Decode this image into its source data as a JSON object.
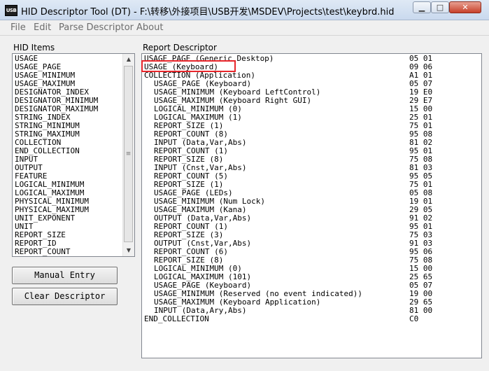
{
  "window": {
    "title": "HID Descriptor Tool (DT) - F:\\转移\\外接项目\\USB开发\\MSDEV\\Projects\\test\\keybrd.hid",
    "app_icon_text": "USB",
    "minimize_glyph": "▁",
    "maximize_glyph": "□",
    "close_glyph": "✕"
  },
  "menu": [
    "File",
    "Edit",
    "Parse Descriptor",
    "About"
  ],
  "hid_items": {
    "label": "HID Items",
    "items": [
      "USAGE",
      "USAGE_PAGE",
      "USAGE_MINIMUM",
      "USAGE_MAXIMUM",
      "DESIGNATOR_INDEX",
      "DESIGNATOR_MINIMUM",
      "DESIGNATOR_MAXIMUM",
      "STRING_INDEX",
      "STRING_MINIMUM",
      "STRING_MAXIMUM",
      "COLLECTION",
      "END_COLLECTION",
      "INPUT",
      "OUTPUT",
      "FEATURE",
      "LOGICAL_MINIMUM",
      "LOGICAL_MAXIMUM",
      "PHYSICAL_MINIMUM",
      "PHYSICAL_MAXIMUM",
      "UNIT_EXPONENT",
      "UNIT",
      "REPORT_SIZE",
      "REPORT_ID",
      "REPORT_COUNT"
    ],
    "scroll_up_glyph": "▲",
    "scroll_down_glyph": "▼",
    "thumb_grip_glyph": "≡"
  },
  "buttons": {
    "manual_entry": "Manual Entry",
    "clear_descriptor": "Clear Descriptor"
  },
  "report": {
    "label": "Report Descriptor",
    "lines": [
      {
        "text": "USAGE_PAGE (Generic Desktop)",
        "hex": "05 01",
        "indent": 0
      },
      {
        "text": "USAGE (Keyboard)",
        "hex": "09 06",
        "indent": 0
      },
      {
        "text": "COLLECTION (Application)",
        "hex": "A1 01",
        "indent": 0
      },
      {
        "text": "USAGE_PAGE (Keyboard)",
        "hex": "05 07",
        "indent": 1
      },
      {
        "text": "USAGE_MINIMUM (Keyboard LeftControl)",
        "hex": "19 E0",
        "indent": 1
      },
      {
        "text": "USAGE_MAXIMUM (Keyboard Right GUI)",
        "hex": "29 E7",
        "indent": 1
      },
      {
        "text": "LOGICAL_MINIMUM (0)",
        "hex": "15 00",
        "indent": 1
      },
      {
        "text": "LOGICAL_MAXIMUM (1)",
        "hex": "25 01",
        "indent": 1
      },
      {
        "text": "REPORT_SIZE (1)",
        "hex": "75 01",
        "indent": 1
      },
      {
        "text": "REPORT_COUNT (8)",
        "hex": "95 08",
        "indent": 1
      },
      {
        "text": "INPUT (Data,Var,Abs)",
        "hex": "81 02",
        "indent": 1
      },
      {
        "text": "REPORT_COUNT (1)",
        "hex": "95 01",
        "indent": 1
      },
      {
        "text": "REPORT_SIZE (8)",
        "hex": "75 08",
        "indent": 1
      },
      {
        "text": "INPUT (Cnst,Var,Abs)",
        "hex": "81 03",
        "indent": 1
      },
      {
        "text": "REPORT_COUNT (5)",
        "hex": "95 05",
        "indent": 1
      },
      {
        "text": "REPORT_SIZE (1)",
        "hex": "75 01",
        "indent": 1
      },
      {
        "text": "USAGE_PAGE (LEDs)",
        "hex": "05 08",
        "indent": 1
      },
      {
        "text": "USAGE_MINIMUM (Num Lock)",
        "hex": "19 01",
        "indent": 1
      },
      {
        "text": "USAGE_MAXIMUM (Kana)",
        "hex": "29 05",
        "indent": 1
      },
      {
        "text": "OUTPUT (Data,Var,Abs)",
        "hex": "91 02",
        "indent": 1
      },
      {
        "text": "REPORT_COUNT (1)",
        "hex": "95 01",
        "indent": 1
      },
      {
        "text": "REPORT_SIZE (3)",
        "hex": "75 03",
        "indent": 1
      },
      {
        "text": "OUTPUT (Cnst,Var,Abs)",
        "hex": "91 03",
        "indent": 1
      },
      {
        "text": "REPORT_COUNT (6)",
        "hex": "95 06",
        "indent": 1
      },
      {
        "text": "REPORT_SIZE (8)",
        "hex": "75 08",
        "indent": 1
      },
      {
        "text": "LOGICAL_MINIMUM (0)",
        "hex": "15 00",
        "indent": 1
      },
      {
        "text": "LOGICAL_MAXIMUM (101)",
        "hex": "25 65",
        "indent": 1
      },
      {
        "text": "USAGE_PAGE (Keyboard)",
        "hex": "05 07",
        "indent": 1
      },
      {
        "text": "USAGE_MINIMUM (Reserved (no event indicated))",
        "hex": "19 00",
        "indent": 1
      },
      {
        "text": "USAGE_MAXIMUM (Keyboard Application)",
        "hex": "29 65",
        "indent": 1
      },
      {
        "text": "INPUT (Data,Ary,Abs)",
        "hex": "81 00",
        "indent": 1
      },
      {
        "text": "END_COLLECTION",
        "hex": "C0",
        "indent": 0
      }
    ],
    "highlighted_line_index": 1
  },
  "colors": {
    "highlight_border": "#e8262b",
    "menu_text": "#6d6d6d"
  }
}
